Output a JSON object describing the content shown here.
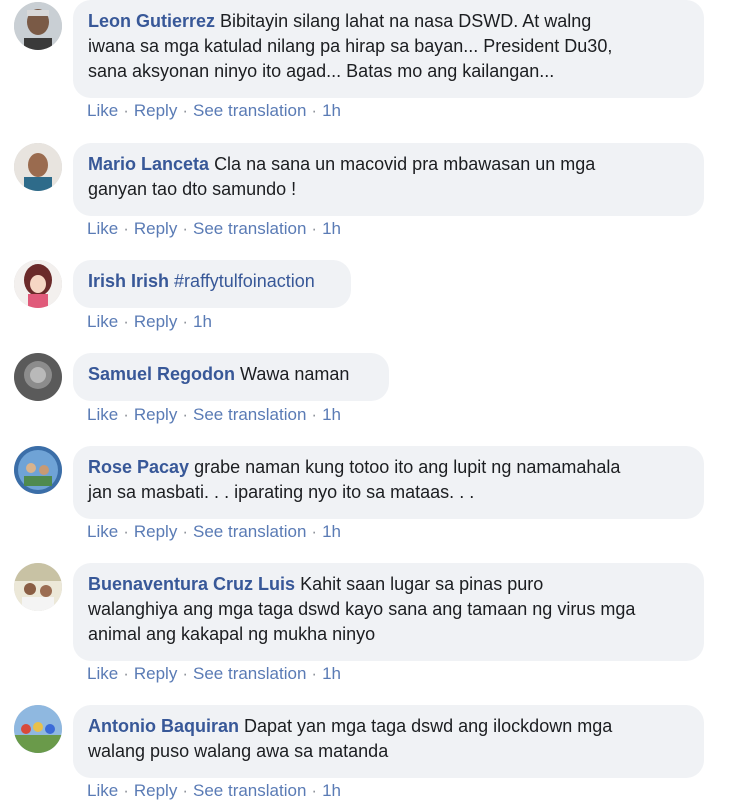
{
  "actions": {
    "like": "Like",
    "reply": "Reply",
    "see_translation": "See translation",
    "separator": "·"
  },
  "comments": [
    {
      "author": "Leon Gutierrez",
      "lines": [
        "Bibitayin silang lahat na nasa DSWD. At walng",
        "iwana sa mga katulad nilang pa hirap sa bayan... President Du30,",
        "sana aksyonan ninyo ito agad... Batas mo ang kailangan..."
      ],
      "time": "1h",
      "translation": true
    },
    {
      "author": "Mario Lanceta",
      "lines": [
        "Cla na sana un macovid pra mbawasan un mga",
        "ganyan tao dto samundo !"
      ],
      "time": "1h",
      "translation": true
    },
    {
      "author": "Irish Irish",
      "tag": "#raffytulfoinaction",
      "lines": [],
      "time": "1h",
      "translation": false
    },
    {
      "author": "Samuel Regodon",
      "lines": [
        "Wawa naman"
      ],
      "time": "1h",
      "translation": true
    },
    {
      "author": "Rose Pacay",
      "lines": [
        "grabe naman kung totoo ito ang lupit ng namamahala",
        "jan sa masbati. . . iparating nyo ito sa mataas. . ."
      ],
      "time": "1h",
      "translation": true
    },
    {
      "author": "Buenaventura Cruz Luis",
      "lines": [
        "Kahit saan lugar sa pinas puro",
        "walanghiya ang mga taga dswd kayo sana ang tamaan ng virus mga",
        "animal ang kakapal ng mukha ninyo"
      ],
      "time": "1h",
      "translation": true
    },
    {
      "author": "Antonio Baquiran",
      "lines": [
        "Dapat yan mga taga dswd ang ilockdown mga",
        "walang puso walang awa sa matanda"
      ],
      "time": "1h",
      "translation": true
    }
  ]
}
